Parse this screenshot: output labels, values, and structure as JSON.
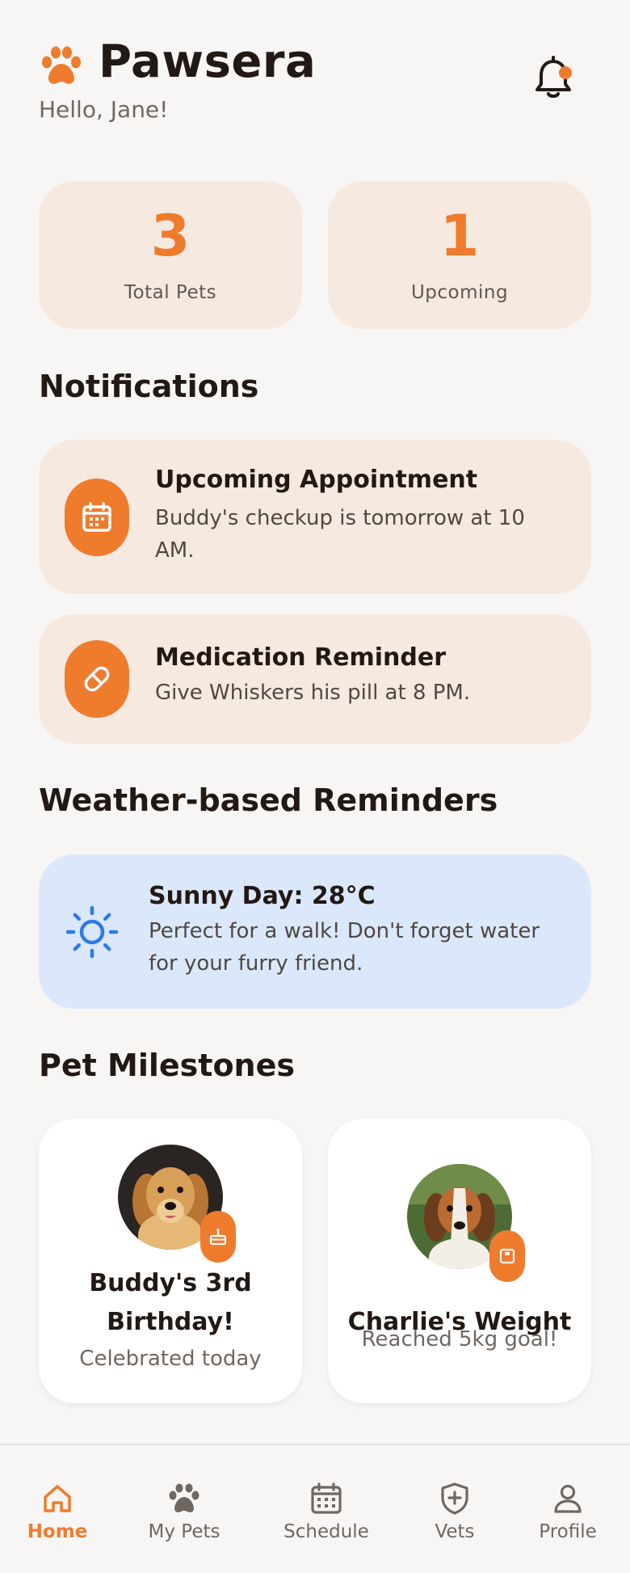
{
  "header": {
    "app_name": "Pawsera",
    "greeting": "Hello, Jane!"
  },
  "stats": [
    {
      "value": "3",
      "label": "Total Pets"
    },
    {
      "value": "1",
      "label": "Upcoming"
    }
  ],
  "notifications": {
    "title": "Notifications",
    "items": [
      {
        "icon": "calendar-icon",
        "title": "Upcoming Appointment",
        "body": "Buddy's checkup is tomorrow at 10 AM."
      },
      {
        "icon": "pill-icon",
        "title": "Medication Reminder",
        "body": "Give Whiskers his pill at 8 PM."
      }
    ]
  },
  "weather": {
    "title": "Weather-based Reminders",
    "card_title": "Sunny Day: 28°C",
    "card_body": "Perfect for a walk! Don't forget water for your furry friend.",
    "icon": "sun-icon"
  },
  "milestones": {
    "title": "Pet Milestones",
    "items": [
      {
        "title": "Buddy's 3rd Birthday!",
        "subtitle": "Celebrated today",
        "badge_icon": "cake-icon",
        "avatar": "golden-retriever-avatar"
      },
      {
        "title": "Charlie's Weight",
        "subtitle": "Reached 5kg goal!",
        "badge_icon": "scale-icon",
        "avatar": "beagle-avatar"
      }
    ]
  },
  "tabs": [
    {
      "label": "Home",
      "icon": "home-icon",
      "active": true
    },
    {
      "label": "My Pets",
      "icon": "paw-icon",
      "active": false
    },
    {
      "label": "Schedule",
      "icon": "calendar-icon",
      "active": false
    },
    {
      "label": "Vets",
      "icon": "shield-plus-icon",
      "active": false
    },
    {
      "label": "Profile",
      "icon": "person-icon",
      "active": false
    }
  ],
  "colors": {
    "accent": "#ef7b2d",
    "card_bg": "#f6e9e0",
    "weather_bg": "#dbe8fc",
    "sun": "#2f7ae5",
    "text": "#221914",
    "muted": "#6f6762"
  }
}
